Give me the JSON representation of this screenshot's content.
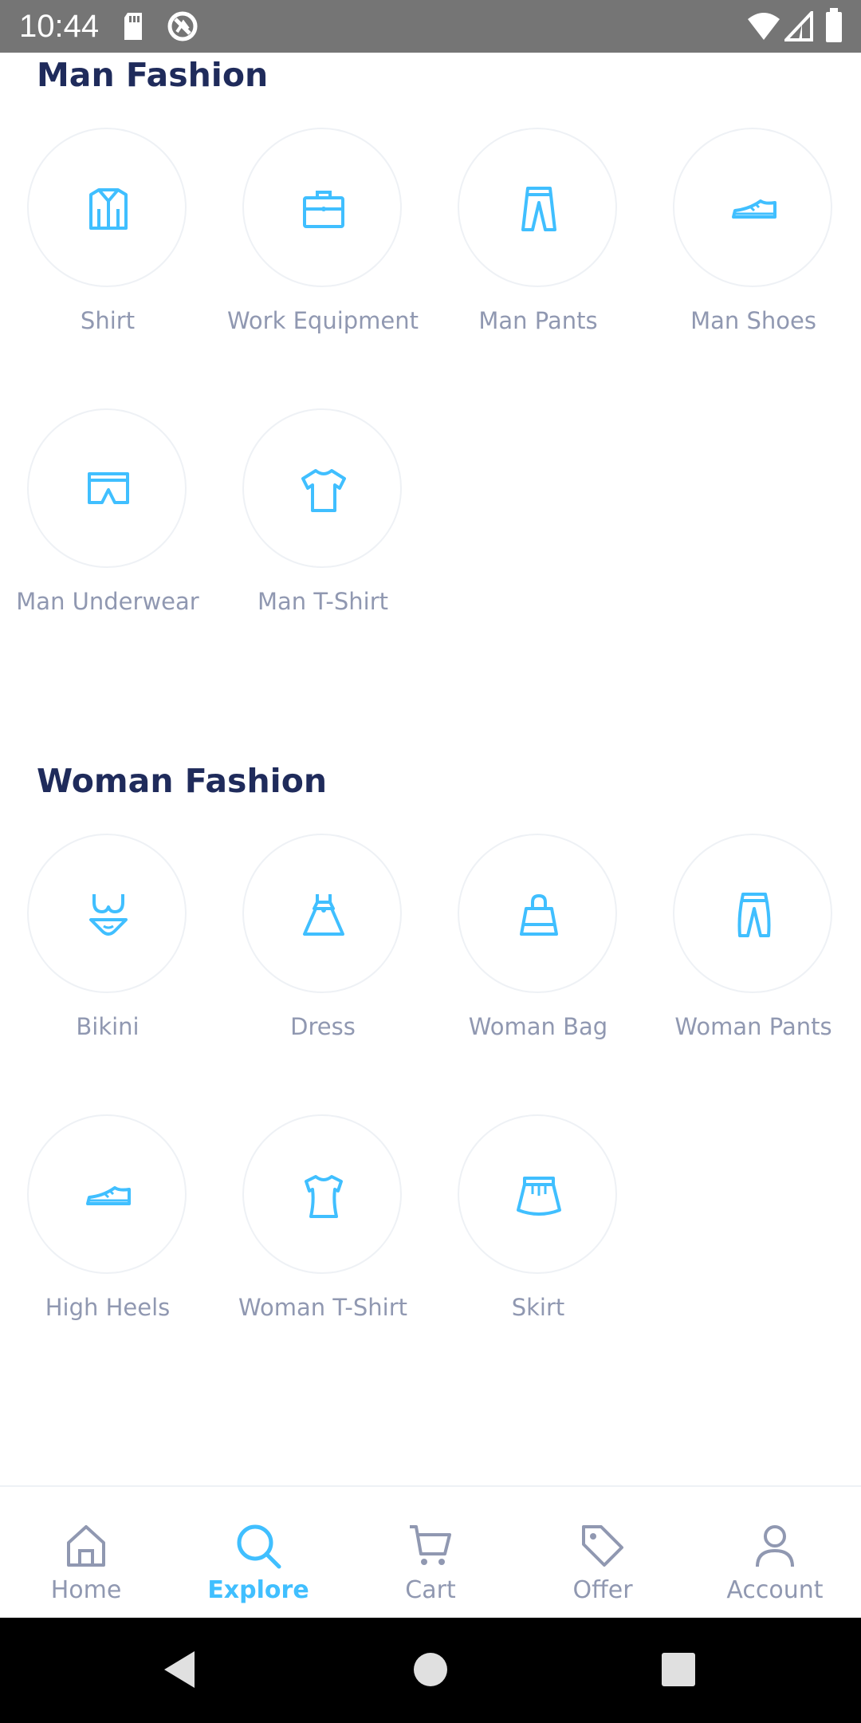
{
  "status_bar": {
    "time": "10:44",
    "icons": [
      "sd-card-icon",
      "sync-icon",
      "wifi-icon",
      "signal-icon",
      "battery-icon"
    ]
  },
  "man_fashion": {
    "title": "Man Fashion",
    "items": [
      {
        "label": "Shirt",
        "icon": "shirt-icon"
      },
      {
        "label": "Work Equipment",
        "icon": "briefcase-icon"
      },
      {
        "label": "Man Pants",
        "icon": "pants-icon"
      },
      {
        "label": "Man Shoes",
        "icon": "shoe-icon"
      },
      {
        "label": "Man Underwear",
        "icon": "underwear-icon"
      },
      {
        "label": "Man T-Shirt",
        "icon": "tshirt-icon"
      }
    ]
  },
  "woman_fashion": {
    "title": "Woman Fashion",
    "items": [
      {
        "label": "Bikini",
        "icon": "bikini-icon"
      },
      {
        "label": "Dress",
        "icon": "dress-icon"
      },
      {
        "label": "Woman Bag",
        "icon": "bag-icon"
      },
      {
        "label": "Woman Pants",
        "icon": "pants-icon"
      },
      {
        "label": "High Heels",
        "icon": "heels-icon"
      },
      {
        "label": "Woman T-Shirt",
        "icon": "tshirt-icon"
      },
      {
        "label": "Skirt",
        "icon": "skirt-icon"
      }
    ]
  },
  "bottom_nav": {
    "items": [
      {
        "label": "Home",
        "icon": "home-icon"
      },
      {
        "label": "Explore",
        "icon": "search-icon",
        "active": true
      },
      {
        "label": "Cart",
        "icon": "cart-icon"
      },
      {
        "label": "Offer",
        "icon": "tag-icon"
      },
      {
        "label": "Account",
        "icon": "user-icon"
      }
    ]
  },
  "colors": {
    "accent": "#40bfff",
    "title": "#1f2b5b",
    "label": "#9098b1",
    "circle_border": "#eef1f5",
    "status_bar": "#757575"
  }
}
